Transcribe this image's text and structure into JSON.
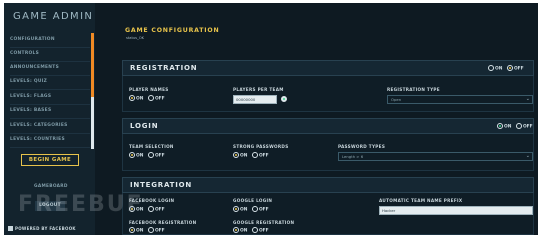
{
  "sidebar": {
    "title": "GAME ADMIN",
    "items": [
      {
        "label": "CONFIGURATION"
      },
      {
        "label": "CONTROLS"
      },
      {
        "label": "ANNOUNCEMENTS"
      },
      {
        "label": "LEVELS: QUIZ"
      },
      {
        "label": "LEVELS: FLAGS"
      },
      {
        "label": "LEVELS: BASES"
      },
      {
        "label": "LEVELS: CATEGORIES"
      },
      {
        "label": "LEVELS: COUNTRIES"
      }
    ],
    "begin_game": "BEGIN GAME",
    "scoreboard": "GAMEBOARD",
    "logout": "LOGOUT",
    "powered_by": "POWERED BY FACEBOOK"
  },
  "main": {
    "title": "GAME CONFIGURATION",
    "status": "status_OK",
    "option_on": "ON",
    "option_off": "OFF",
    "registration": {
      "label": "REGISTRATION",
      "section_state": "off",
      "player_names_label": "PLAYER NAMES",
      "player_names_state": "on",
      "players_per_team_label": "PLAYERS PER TEAM",
      "players_per_team_value": "00000000",
      "registration_type_label": "REGISTRATION TYPE",
      "registration_type_value": "Open"
    },
    "login": {
      "label": "LOGIN",
      "section_state": "on",
      "team_selection_label": "TEAM SELECTION",
      "team_selection_state": "on",
      "strong_passwords_label": "STRONG PASSWORDS",
      "strong_passwords_state": "on",
      "password_types_label": "PASSWORD TYPES",
      "password_types_value": "Length > 6"
    },
    "integration": {
      "label": "INTEGRATION",
      "facebook_login_label": "FACEBOOK LOGIN",
      "facebook_login_state": "on",
      "google_login_label": "GOOGLE LOGIN",
      "google_login_state": "on",
      "team_prefix_label": "AUTOMATIC TEAM NAME PREFIX",
      "team_prefix_value": "Hacker",
      "facebook_registration_label": "FACEBOOK REGISTRATION",
      "facebook_registration_state": "on",
      "google_registration_label": "GOOGLE REGISTRATION",
      "google_registration_state": "on"
    }
  },
  "watermark": "FREEBUF"
}
